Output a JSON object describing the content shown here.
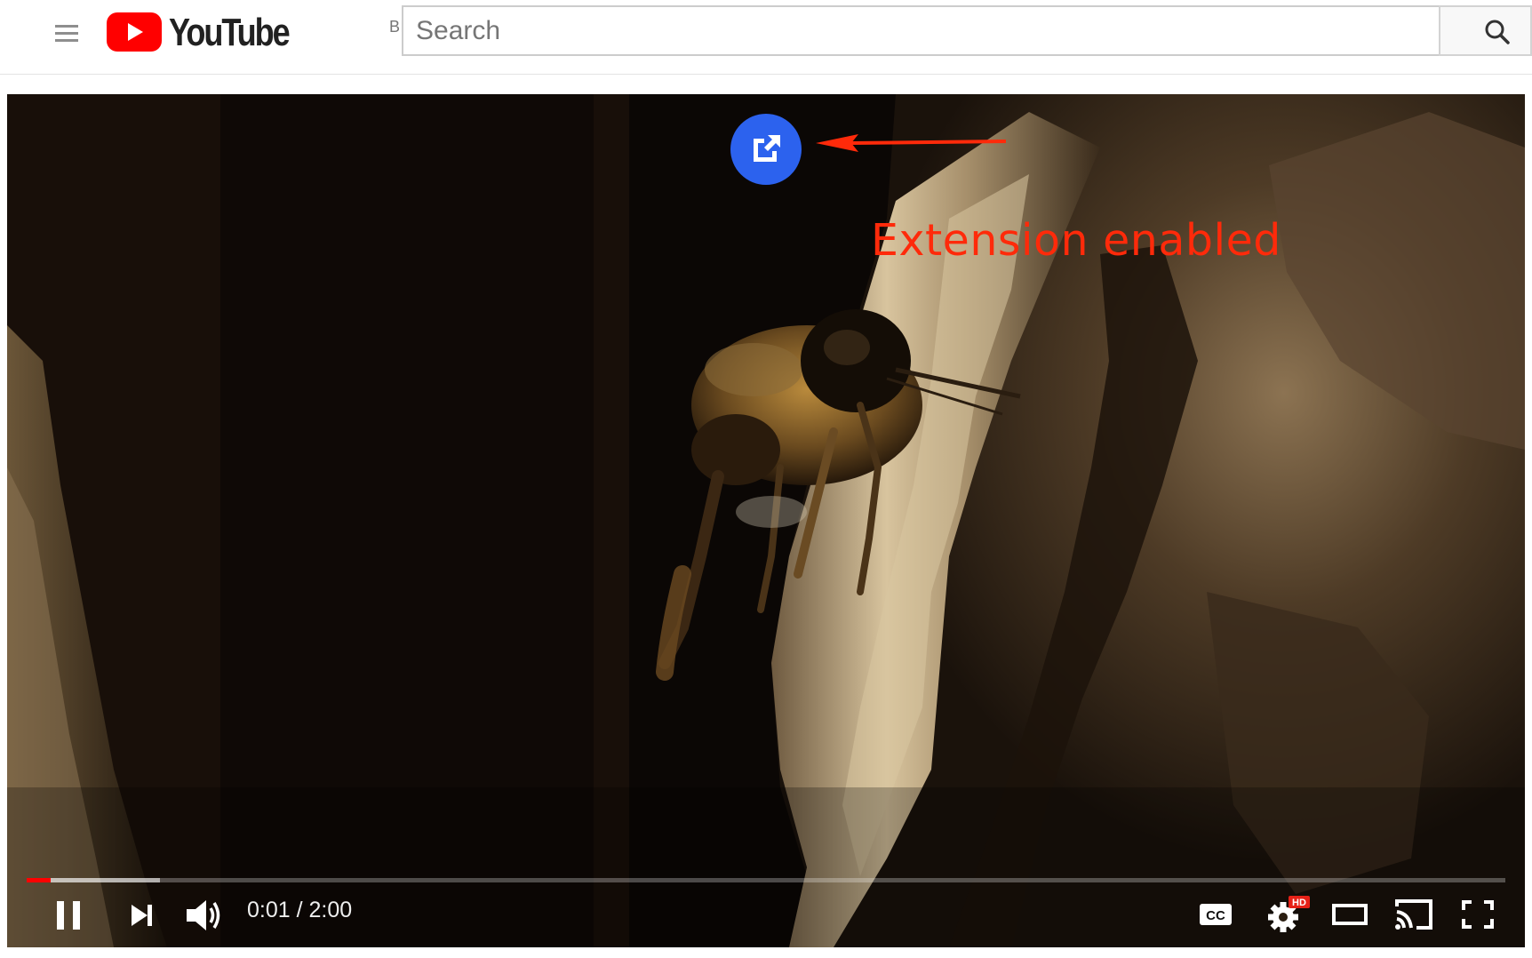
{
  "header": {
    "logo_text": "YouTube",
    "region_code": "BR",
    "search_placeholder": "Search"
  },
  "player": {
    "annotation_text": "Extension enabled",
    "current_time": "0:01",
    "time_separator": " / ",
    "duration": "2:00",
    "progress_played_fraction": 0.016,
    "progress_loaded_fraction": 0.09,
    "hd_badge": "HD",
    "cc_label": "CC"
  },
  "colors": {
    "brand_red": "#ff0000",
    "extension_blue": "#2c62ee",
    "annotation_red": "#ff2a0a"
  },
  "icons": [
    "menu-icon",
    "youtube-play-icon",
    "search-icon",
    "open-external-icon",
    "pause-icon",
    "next-icon",
    "volume-icon",
    "subtitles-icon",
    "settings-icon",
    "theater-mode-icon",
    "cast-icon",
    "fullscreen-icon"
  ]
}
